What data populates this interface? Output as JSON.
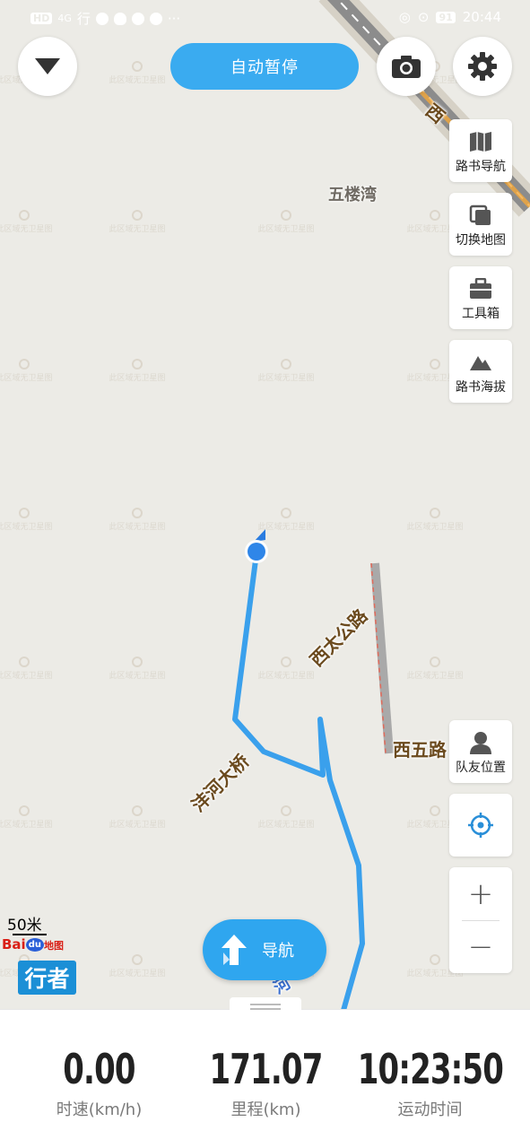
{
  "status_bar": {
    "left_icons": [
      "hd-icon",
      "signal-icon",
      "xingzhe-app-icon",
      "browser-icon",
      "qq-icon",
      "wechat-icon",
      "message-icon"
    ],
    "hd": "HD",
    "network": "4G",
    "app_char": "行",
    "more": "···",
    "battery": "91",
    "time": "20:44"
  },
  "top_bar": {
    "pause_label": "自动暂停"
  },
  "side_panel": {
    "items": [
      {
        "label": "路书导航",
        "icon": "map-book-icon"
      },
      {
        "label": "切换地图",
        "icon": "layers-icon"
      },
      {
        "label": "工具箱",
        "icon": "toolbox-icon"
      },
      {
        "label": "路书海拔",
        "icon": "mountain-icon"
      }
    ],
    "teammate_label": "队友位置",
    "zoom_in": "+",
    "zoom_out": "−"
  },
  "map": {
    "village_label": "五楼湾",
    "road_labels": [
      "西太公路",
      "西五路",
      "沣河大桥"
    ],
    "corner_label": "西",
    "river_label": "河",
    "watermark": "此区域无卫星图"
  },
  "map_footer": {
    "scale": "50米",
    "baidu_brand": "Bai",
    "baidu_du": "du",
    "baidu_map": "地图",
    "xingzhe_logo": "行者"
  },
  "nav_button": {
    "label": "导航"
  },
  "stats": [
    {
      "value": "0.00",
      "label": "时速(km/h)"
    },
    {
      "value": "171.07",
      "label": "里程(km)"
    },
    {
      "value": "10:23:50",
      "label": "运动时间"
    }
  ]
}
